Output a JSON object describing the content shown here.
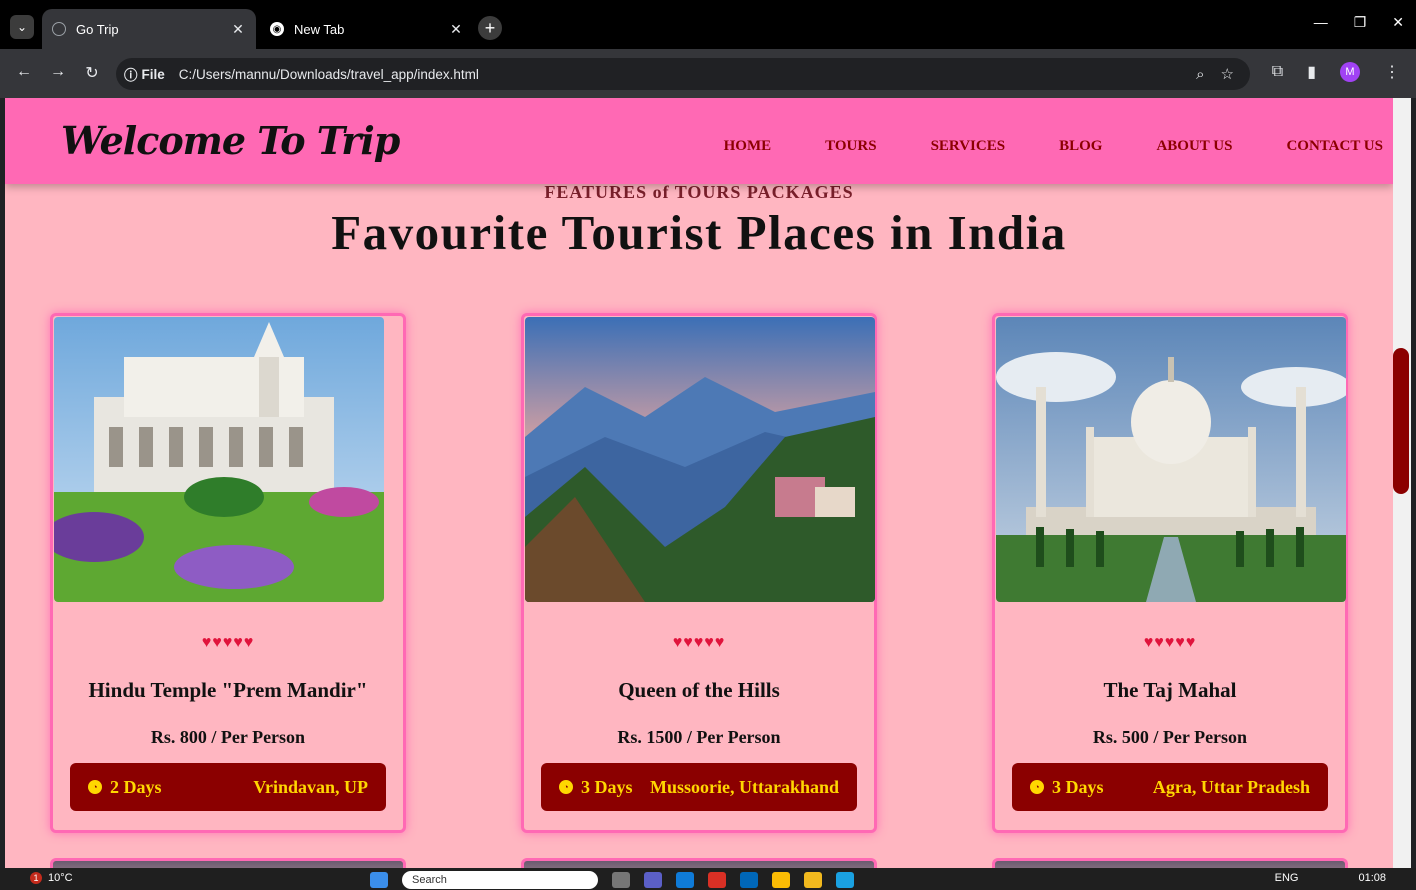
{
  "browser": {
    "tabs": [
      {
        "title": "Go Trip",
        "active": true
      },
      {
        "title": "New Tab",
        "active": false
      }
    ],
    "new_tab": "+",
    "omnibox": {
      "chip_label": "File",
      "url": "C:/Users/mannu/Downloads/travel_app/index.html"
    },
    "profile_initial": "M"
  },
  "site": {
    "logo": "Welcome To Trip",
    "nav": [
      "HOME",
      "TOURS",
      "SERVICES",
      "BLOG",
      "ABOUT US",
      "CONTACT US"
    ],
    "section_label": "FEATURES of TOURS PACKAGES",
    "heading": "Favourite Tourist Places in India",
    "cards": [
      {
        "rating": "♥♥♥♥♥",
        "title": "Hindu Temple \"Prem Mandir\"",
        "price": "Rs. 800 / Per Person",
        "duration": "2 Days",
        "location": "Vrindavan, UP"
      },
      {
        "rating": "♥♥♥♥♥",
        "title": "Queen of the Hills",
        "price": "Rs. 1500 / Per Person",
        "duration": "3 Days",
        "location": "Mussoorie, Uttarakhand"
      },
      {
        "rating": "♥♥♥♥♥",
        "title": "The Taj Mahal",
        "price": "Rs. 500 / Per Person",
        "duration": "3 Days",
        "location": "Agra, Uttar Pradesh"
      }
    ]
  },
  "taskbar": {
    "weather": "10°C",
    "notification_count": "1",
    "search_placeholder": "Search",
    "language": "ENG",
    "time": "01:08"
  },
  "colors": {
    "header_bg": "#ff69b4",
    "page_bg": "#ffb6c1",
    "accent_dark": "#8b0000",
    "accent_gold": "#ffd700"
  }
}
